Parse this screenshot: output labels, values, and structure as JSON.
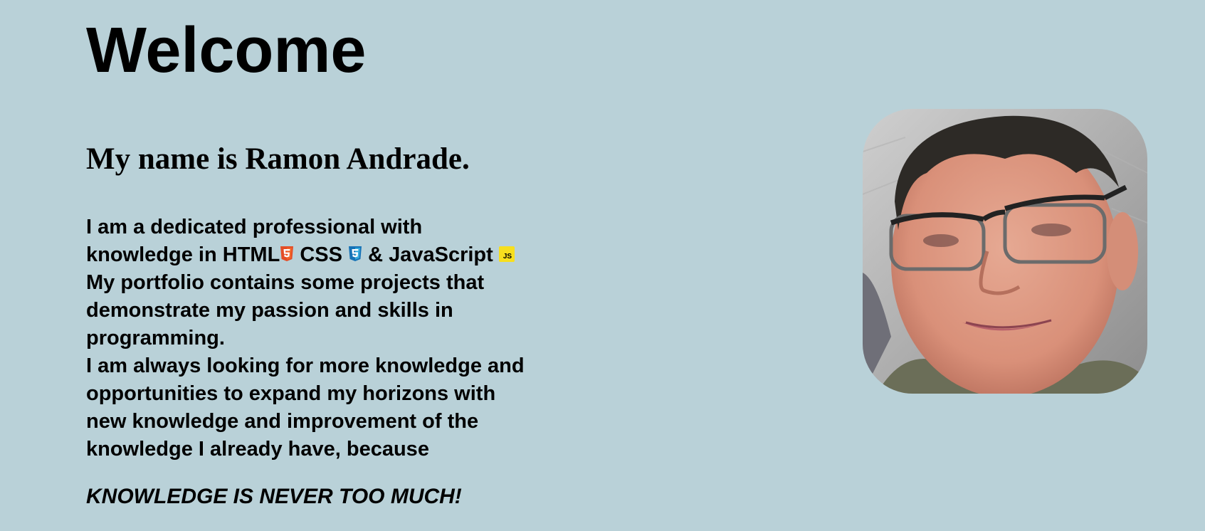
{
  "header": {
    "title": "Welcome"
  },
  "intro": {
    "name_line": "My name is Ramon Andrade."
  },
  "bio": {
    "line1": "I am a dedicated professional with",
    "line2_prefix": "knowledge in",
    "tech": [
      {
        "label": "HTML",
        "icon": "html5-icon",
        "color": "#e44d26"
      },
      {
        "label": "CSS",
        "icon": "css3-icon",
        "color": "#2965f1"
      },
      {
        "label": "& JavaScript",
        "icon": "javascript-icon",
        "color": "#f7df1e"
      }
    ],
    "line3": "My portfolio contains some projects that",
    "line4": "demonstrate my passion and skills in",
    "line5": "programming.",
    "line6": "I am always looking for more knowledge and",
    "line7": "opportunities to expand my horizons with",
    "line8": "new knowledge and improvement of the",
    "line9": "knowledge I already have, because"
  },
  "motto": "KNOWLEDGE IS NEVER TOO MUCH!",
  "js_badge_text": "JS",
  "colors": {
    "background": "#b9d1d8",
    "text": "#000000"
  }
}
